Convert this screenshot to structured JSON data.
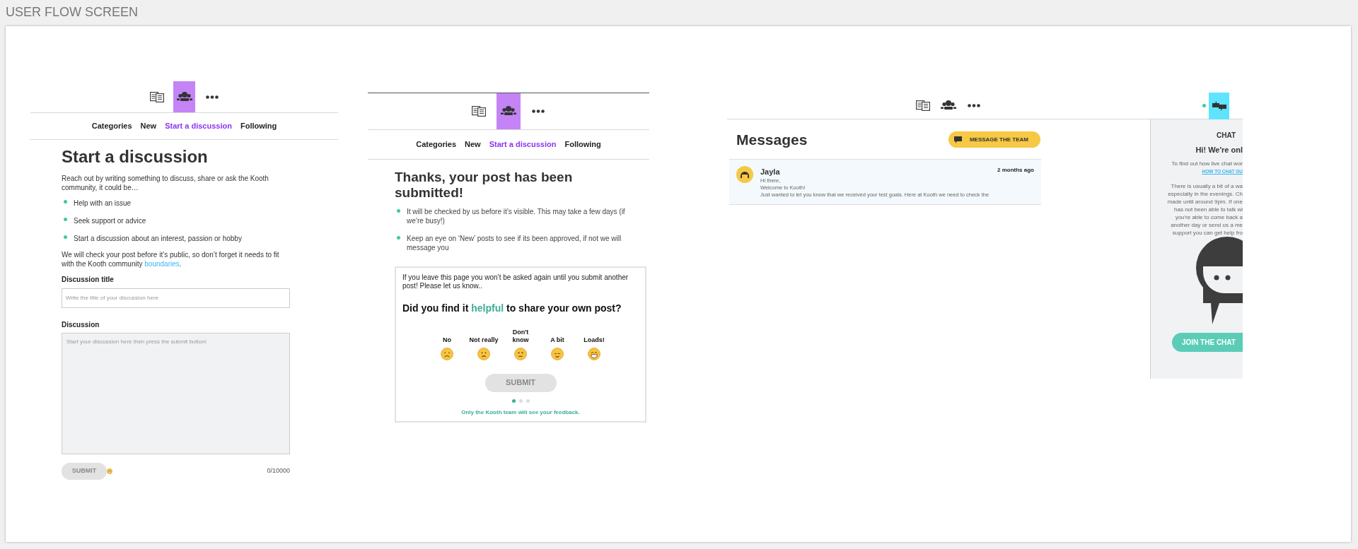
{
  "board": {
    "title": "USER FLOW SCREEN"
  },
  "start_screen": {
    "nav": [
      {
        "kind": "articles",
        "selected": false
      },
      {
        "kind": "community",
        "selected": true
      },
      {
        "kind": "more",
        "selected": false
      }
    ],
    "tabs": [
      {
        "label": "Categories",
        "selected": false
      },
      {
        "label": "New",
        "selected": false
      },
      {
        "label": "Start a discussion",
        "selected": true
      },
      {
        "label": "Following",
        "selected": false
      }
    ],
    "title": "Start a discussion",
    "intro": "Reach out by writing something to discuss, share or ask the Kooth community, it could be…",
    "bullets": [
      "Help with an issue",
      "Seek support or advice",
      "Start a discussion about an interest, passion or hobby"
    ],
    "note": {
      "text": "We will check your post before it’s public, so don’t forget it needs to fit with the Kooth community ",
      "link": "boundaries",
      "end": "."
    },
    "title_field": {
      "label": "Discussion title",
      "placeholder": "Write the title of your discussion here"
    },
    "discussion_field": {
      "label": "Discussion",
      "placeholder": "Start your discussion here then press the submit button!"
    },
    "submit": {
      "label": "SUBMIT",
      "disabled": true
    },
    "counter": "0/10000"
  },
  "submitted_screen": {
    "nav": [
      {
        "kind": "articles",
        "selected": false
      },
      {
        "kind": "community",
        "selected": true
      },
      {
        "kind": "more",
        "selected": false
      }
    ],
    "tabs": [
      {
        "label": "Categories",
        "selected": false
      },
      {
        "label": "New",
        "selected": false
      },
      {
        "label": "Start a discussion",
        "selected": true
      },
      {
        "label": "Following",
        "selected": false
      }
    ],
    "title": "Thanks, your post has been submitted!",
    "bullets": [
      "It will be checked by us before it’s visible. This may take a few days (if we’re busy!)",
      "Keep an eye on ‘New’ posts to see if its been approved, if not we will message you"
    ],
    "feedback": {
      "intro": "If you leave this page you won’t be asked again until you submit another post! Please let us know..",
      "question_before": "Did you find it ",
      "question_highlight": "helpful",
      "question_after": " to share your own post?",
      "options": [
        {
          "label": "No",
          "kind": "sad"
        },
        {
          "label": "Not really",
          "kind": "confused"
        },
        {
          "label": "Don't know",
          "kind": "neutral"
        },
        {
          "label": "A bit",
          "kind": "relieved"
        },
        {
          "label": "Loads!",
          "kind": "grin"
        }
      ],
      "submit": {
        "label": "SUBMIT",
        "disabled": true
      },
      "pager": [
        {
          "selected": true
        },
        {
          "selected": false
        },
        {
          "selected": false
        }
      ],
      "footer": "Only the Kooth team will see your feedback."
    }
  },
  "messages_screen": {
    "nav": [
      {
        "kind": "articles",
        "selected": false
      },
      {
        "kind": "community",
        "selected": false
      },
      {
        "kind": "more",
        "selected": false
      },
      {
        "kind": "chat",
        "selected": true
      }
    ],
    "title": "Messages",
    "button": "MESSAGE THE TEAM",
    "message": {
      "sender": "Jayla",
      "time": "2 months ago",
      "lines": [
        "Hi there,",
        "Welcome to Kooth!",
        "Just wanted to let you know that we received your test goals. Here at Kooth we need to check the"
      ]
    },
    "chat": {
      "heading": "CHAT",
      "greeting": "Hi! We're onl",
      "intro": "To find out how live chat wor",
      "link": "HOW TO CHAT GU",
      "lines": [
        "There is usually a bit of a wa",
        "especially in the evenings. Ch",
        "made until around 9pm. If one",
        "has not been able to talk wi",
        "you're able to come back a",
        "another day or send us a me",
        "support you can get help fro"
      ],
      "button": "JOIN THE CHAT"
    }
  }
}
